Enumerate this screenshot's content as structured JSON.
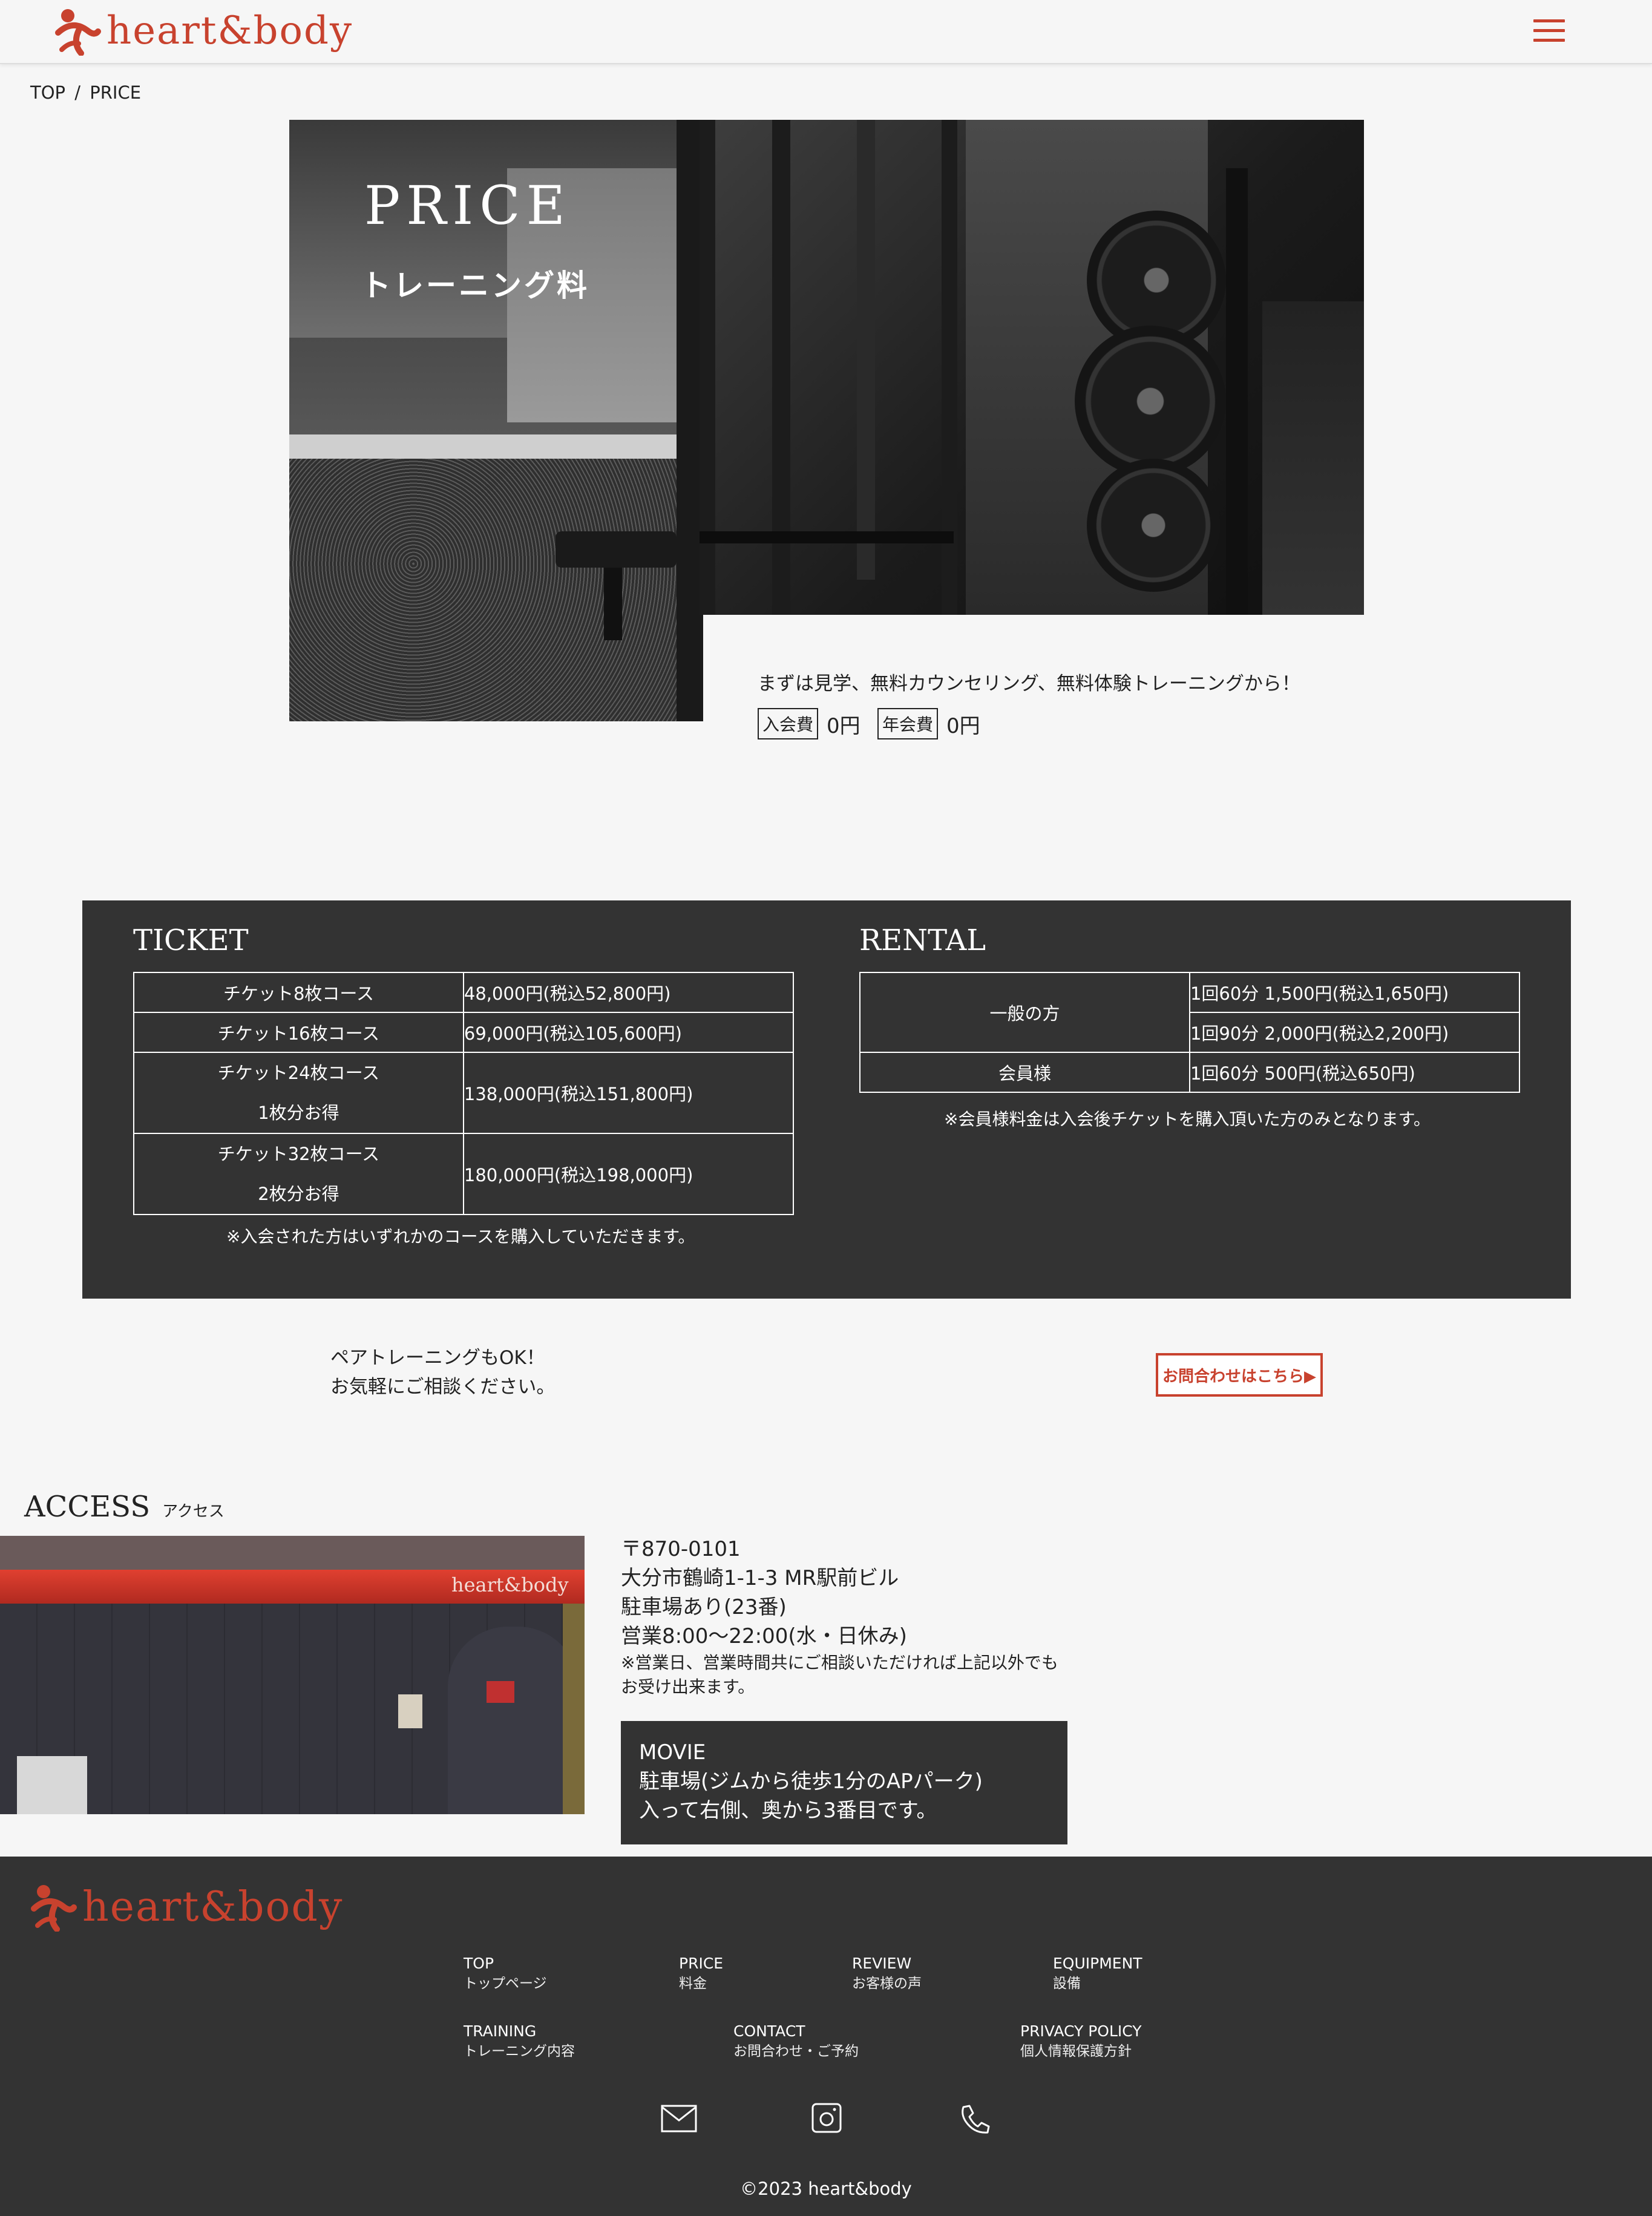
{
  "header": {
    "logo_text": "heart&body",
    "brand_color": "#c8422e"
  },
  "breadcrumb": {
    "home": "TOP",
    "separator": "/",
    "current": "PRICE"
  },
  "hero": {
    "title": "PRICE",
    "subtitle": "トレーニング料",
    "lead": "まずは見学、無料カウンセリング、無料体験トレーニングから！",
    "fees": [
      {
        "label": "入会費",
        "value": "0円"
      },
      {
        "label": "年会費",
        "value": "0円"
      }
    ]
  },
  "ticket": {
    "heading": "TICKET",
    "rows": [
      {
        "course": "チケット8枚コース",
        "extra": "",
        "price": "48,000円(税込52,800円)"
      },
      {
        "course": "チケット16枚コース",
        "extra": "",
        "price": "69,000円(税込105,600円)"
      },
      {
        "course": "チケット24枚コース",
        "extra": "1枚分お得",
        "price": "138,000円(税込151,800円)"
      },
      {
        "course": "チケット32枚コース",
        "extra": "2枚分お得",
        "price": "180,000円(税込198,000円)"
      }
    ],
    "note": "※入会された方はいずれかのコースを購入していただきます。"
  },
  "rental": {
    "heading": "RENTAL",
    "general_label": "一般の方",
    "general_prices": [
      "1回60分 1,500円(税込1,650円)",
      "1回90分 2,000円(税込2,200円)"
    ],
    "member_label": "会員様",
    "member_price": "1回60分 500円(税込650円)",
    "note": "※会員様料金は入会後チケットを購入頂いた方のみとなります。"
  },
  "pair": {
    "line1": "ペアトレーニングもOK！",
    "line2": "お気軽にご相談ください。",
    "button": "お問合わせはこちら▶"
  },
  "access": {
    "heading": "ACCESS",
    "heading_ja": "アクセス",
    "photo_sign": "heart&body",
    "postal": "〒870-0101",
    "address": "大分市鶴崎1-1-3 MR駅前ビル",
    "parking": "駐車場あり(23番)",
    "hours": "営業8:00～22:00(水・日休み)",
    "note_line1": "※営業日、営業時間共にご相談いただければ上記以外でも",
    "note_line2": "お受け出来ます。",
    "movie_title": "MOVIE",
    "movie_line1": "駐車場(ジムから徒歩1分のAPパーク)",
    "movie_line2": "入って右側、奥から3番目です。"
  },
  "footer": {
    "logo_text": "heart&body",
    "nav": [
      {
        "en": "TOP",
        "ja": "トップページ"
      },
      {
        "en": "PRICE",
        "ja": "料金"
      },
      {
        "en": "REVIEW",
        "ja": "お客様の声"
      },
      {
        "en": "EQUIPMENT",
        "ja": "設備"
      },
      {
        "en": "TRAINING",
        "ja": "トレーニング内容"
      },
      {
        "en": "CONTACT",
        "ja": "お問合わせ・ご予約"
      },
      {
        "en": "PRIVACY POLICY",
        "ja": "個人情報保護方針"
      }
    ],
    "icons": [
      "mail-icon",
      "instagram-icon",
      "phone-icon"
    ],
    "copyright": "©2023 heart&body"
  }
}
